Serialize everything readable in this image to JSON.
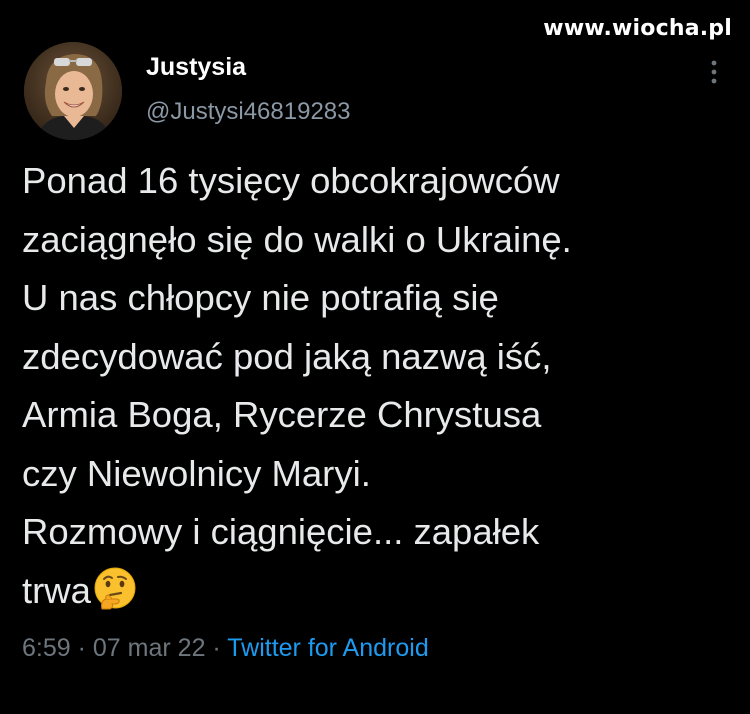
{
  "watermark": "www.wiocha.pl",
  "author": {
    "name": "Justysia",
    "handle": "@Justysi46819283"
  },
  "tweet": {
    "lines": [
      "Ponad 16 tysięcy obcokrajowców",
      "zaciągnęło się do walki o Ukrainę.",
      "U nas chłopcy nie potrafią się",
      "zdecydować pod jaką nazwą iść,",
      "Armia Boga, Rycerze Chrystusa",
      "czy Niewolnicy Maryi.",
      "Rozmowy i ciągnięcie... zapałek",
      "trwa"
    ],
    "emoji": "thinking-face-icon"
  },
  "meta": {
    "time": "6:59",
    "separator": "·",
    "date": "07 mar 22",
    "source": "Twitter for Android"
  },
  "colors": {
    "background": "#000000",
    "text": "#e7e9ea",
    "secondary": "#6e767d",
    "link": "#1d9bf0"
  }
}
